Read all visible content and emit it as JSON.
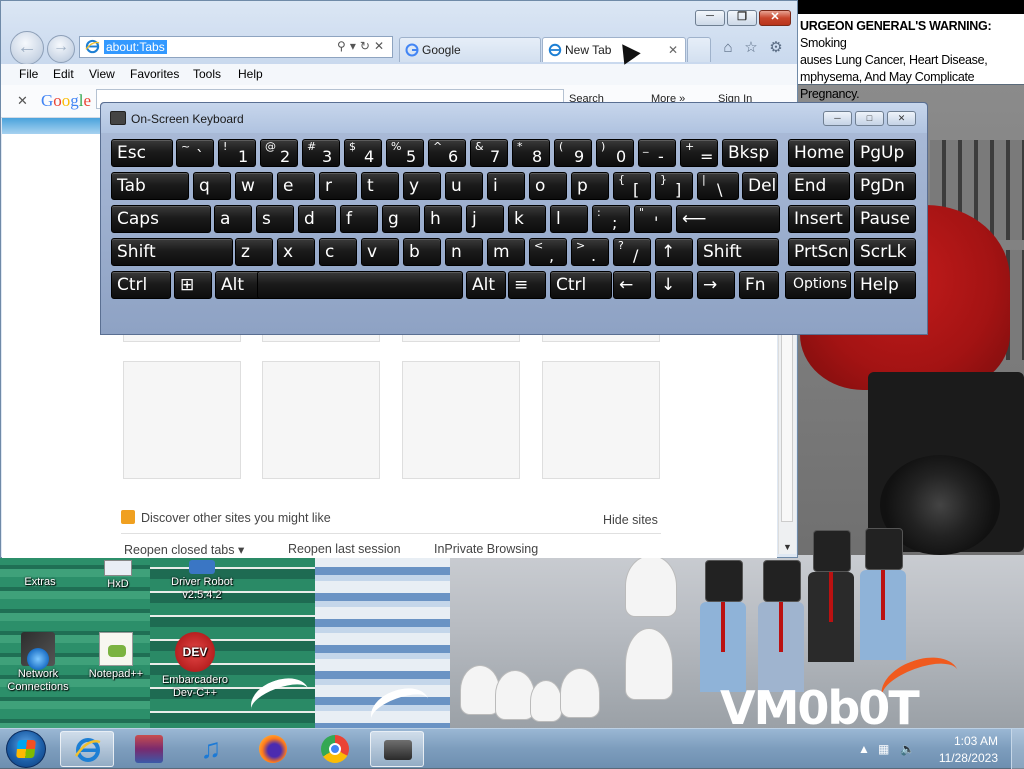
{
  "desktop": {
    "warning_sign": {
      "heading": "URGEON GENERAL'S WARNING:",
      "line1": " Smoking",
      "line2": "auses Lung Cancer, Heart Disease,",
      "line3": "mphysema, And May Complicate Pregnancy."
    },
    "logo_text": "VM0b0T",
    "icons": [
      {
        "label": "Extras"
      },
      {
        "label": "HxD"
      },
      {
        "label": "Driver Robot v2.5.4.2"
      },
      {
        "label": "Network Connections"
      },
      {
        "label": "Notepad++"
      },
      {
        "label": "Embarcadero Dev-C++"
      }
    ]
  },
  "browser": {
    "address": "about:Tabs",
    "tabs": [
      {
        "label": "Google",
        "icon": "google-g-icon"
      },
      {
        "label": "New Tab",
        "icon": "ie-icon"
      }
    ],
    "menu": [
      "File",
      "Edit",
      "View",
      "Favorites",
      "Tools",
      "Help"
    ],
    "google_toolbar": {
      "logo": "Google",
      "search_label": "Search",
      "more_label": "More »",
      "signin_label": "Sign In"
    },
    "newtab_page": {
      "discover_text": "Discover other sites you might like",
      "hide_sites": "Hide sites",
      "bottom_links": [
        "Reopen closed tabs ▾",
        "Reopen last session",
        "InPrivate Browsing"
      ]
    }
  },
  "osk": {
    "title": "On-Screen Keyboard",
    "rows": [
      [
        {
          "t": "Esc"
        },
        {
          "s": "~",
          "m": "`"
        },
        {
          "s": "!",
          "m": "1"
        },
        {
          "s": "@",
          "m": "2"
        },
        {
          "s": "#",
          "m": "3"
        },
        {
          "s": "$",
          "m": "4"
        },
        {
          "s": "%",
          "m": "5"
        },
        {
          "s": "^",
          "m": "6"
        },
        {
          "s": "&",
          "m": "7"
        },
        {
          "s": "*",
          "m": "8"
        },
        {
          "s": "(",
          "m": "9"
        },
        {
          "s": ")",
          "m": "0"
        },
        {
          "s": "_",
          "m": "-"
        },
        {
          "s": "+",
          "m": "="
        },
        {
          "t": "Bksp"
        },
        {
          "t": "Home"
        },
        {
          "t": "PgUp"
        }
      ],
      [
        {
          "t": "Tab"
        },
        {
          "t": "q"
        },
        {
          "t": "w"
        },
        {
          "t": "e"
        },
        {
          "t": "r"
        },
        {
          "t": "t"
        },
        {
          "t": "y"
        },
        {
          "t": "u"
        },
        {
          "t": "i"
        },
        {
          "t": "o"
        },
        {
          "t": "p"
        },
        {
          "s": "{",
          "m": "["
        },
        {
          "s": "}",
          "m": "]"
        },
        {
          "s": "|",
          "m": "\\"
        },
        {
          "t": "Del"
        },
        {
          "t": "End"
        },
        {
          "t": "PgDn"
        }
      ],
      [
        {
          "t": "Caps"
        },
        {
          "t": "a"
        },
        {
          "t": "s"
        },
        {
          "t": "d"
        },
        {
          "t": "f"
        },
        {
          "t": "g"
        },
        {
          "t": "h"
        },
        {
          "t": "j"
        },
        {
          "t": "k"
        },
        {
          "t": "l"
        },
        {
          "s": ":",
          "m": ";"
        },
        {
          "s": "\"",
          "m": "'"
        },
        {
          "t": "⟵"
        },
        {
          "t": "Insert"
        },
        {
          "t": "Pause"
        }
      ],
      [
        {
          "t": "Shift"
        },
        {
          "t": "z"
        },
        {
          "t": "x"
        },
        {
          "t": "c"
        },
        {
          "t": "v"
        },
        {
          "t": "b"
        },
        {
          "t": "n"
        },
        {
          "t": "m"
        },
        {
          "s": "<",
          "m": ","
        },
        {
          "s": ">",
          "m": "."
        },
        {
          "s": "?",
          "m": "/"
        },
        {
          "t": "↑"
        },
        {
          "t": "Shift"
        },
        {
          "t": "PrtScn"
        },
        {
          "t": "ScrLk"
        }
      ],
      [
        {
          "t": "Ctrl"
        },
        {
          "t": "⊞"
        },
        {
          "t": "Alt"
        },
        {
          "t": ""
        },
        {
          "t": "Alt"
        },
        {
          "t": "≡"
        },
        {
          "t": "Ctrl"
        },
        {
          "t": "←"
        },
        {
          "t": "↓"
        },
        {
          "t": "→"
        },
        {
          "t": "Fn"
        },
        {
          "t": "Options"
        },
        {
          "t": "Help"
        }
      ]
    ]
  },
  "taskbar": {
    "time": "1:03 AM",
    "date": "11/28/2023",
    "pinned": [
      "ie-icon",
      "archive-icon",
      "music-note-icon",
      "firefox-icon",
      "chrome-icon",
      "osk-keyboard-icon"
    ]
  }
}
